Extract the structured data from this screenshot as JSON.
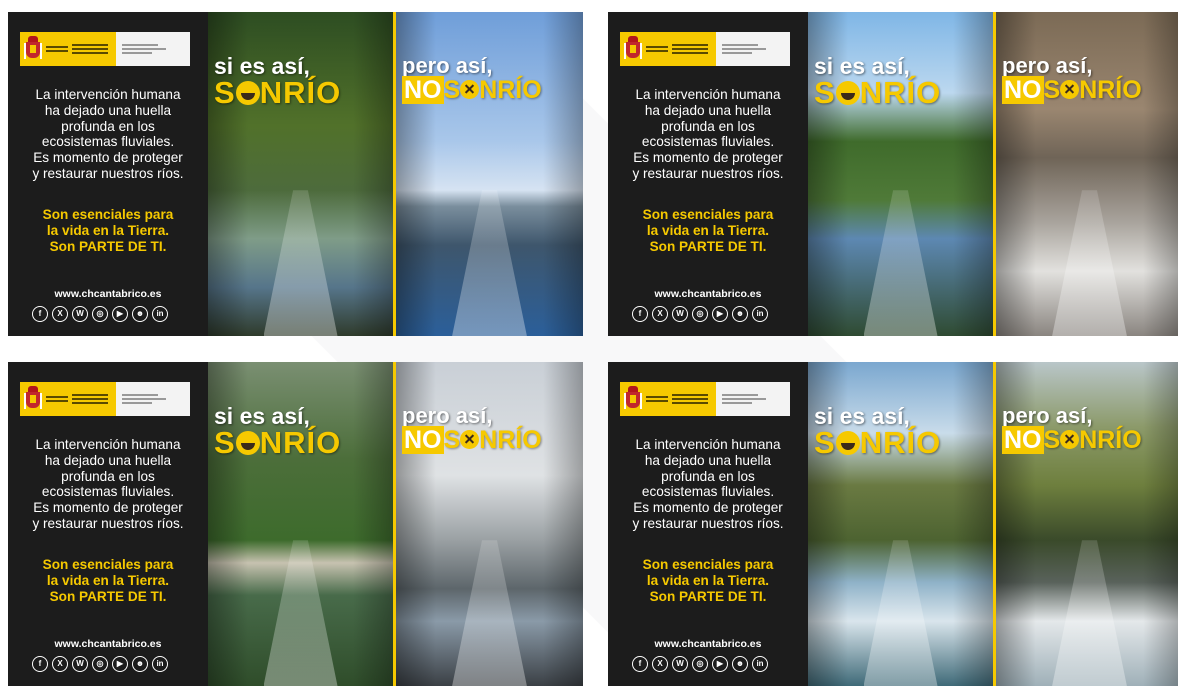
{
  "colors": {
    "accent": "#f6c900",
    "panel": "#1c1c1c",
    "background": "#ffffff"
  },
  "posters": [
    {
      "body_lines": [
        "La intervención humana",
        "ha dejado una huella",
        "profunda en los",
        "ecosistemas fluviales.",
        "Es momento de proteger",
        "y restaurar nuestros ríos."
      ],
      "claim_lines": [
        "Son esenciales para",
        "la vida en la Tierra.",
        "Son PARTE DE TI."
      ],
      "website": "www.chcantabrico.es",
      "good": {
        "lead": "si es así,",
        "word": "S",
        "word_rest": "NRÍO"
      },
      "bad": {
        "lead": "pero así,",
        "no": "NO",
        "word": "S",
        "word_rest": "NRÍO"
      }
    },
    {
      "body_lines": [
        "La intervención humana",
        "ha dejado una huella",
        "profunda en los",
        "ecosistemas fluviales.",
        "Es momento de proteger",
        "y restaurar nuestros ríos."
      ],
      "claim_lines": [
        "Son esenciales para",
        "la vida en la Tierra.",
        "Son PARTE DE TI."
      ],
      "website": "www.chcantabrico.es",
      "good": {
        "lead": "si es así,",
        "word": "S",
        "word_rest": "NRÍO"
      },
      "bad": {
        "lead": "pero así,",
        "no": "NO",
        "word": "S",
        "word_rest": "NRÍO"
      }
    },
    {
      "body_lines": [
        "La intervención humana",
        "ha dejado una huella",
        "profunda en los",
        "ecosistemas fluviales.",
        "Es momento de proteger",
        "y restaurar nuestros ríos."
      ],
      "claim_lines": [
        "Son esenciales para",
        "la vida en la Tierra.",
        "Son PARTE DE TI."
      ],
      "website": "www.chcantabrico.es",
      "good": {
        "lead": "si es así,",
        "word": "S",
        "word_rest": "NRÍO"
      },
      "bad": {
        "lead": "pero así,",
        "no": "NO",
        "word": "S",
        "word_rest": "NRÍO"
      }
    },
    {
      "body_lines": [
        "La intervención humana",
        "ha dejado una huella",
        "profunda en los",
        "ecosistemas fluviales.",
        "Es momento de proteger",
        "y restaurar nuestros ríos."
      ],
      "claim_lines": [
        "Son esenciales para",
        "la vida en la Tierra.",
        "Son PARTE DE TI."
      ],
      "website": "www.chcantabrico.es",
      "good": {
        "lead": "si es así,",
        "word": "S",
        "word_rest": "NRÍO"
      },
      "bad": {
        "lead": "pero así,",
        "no": "NO",
        "word": "S",
        "word_rest": "NRÍO"
      }
    }
  ],
  "social_icons": [
    "facebook-icon",
    "x-icon",
    "bluesky-icon",
    "instagram-icon",
    "youtube-icon",
    "flickr-icon",
    "linkedin-icon"
  ],
  "social_glyphs": [
    "f",
    "X",
    "W",
    "◎",
    "▶",
    "☻",
    "in"
  ]
}
